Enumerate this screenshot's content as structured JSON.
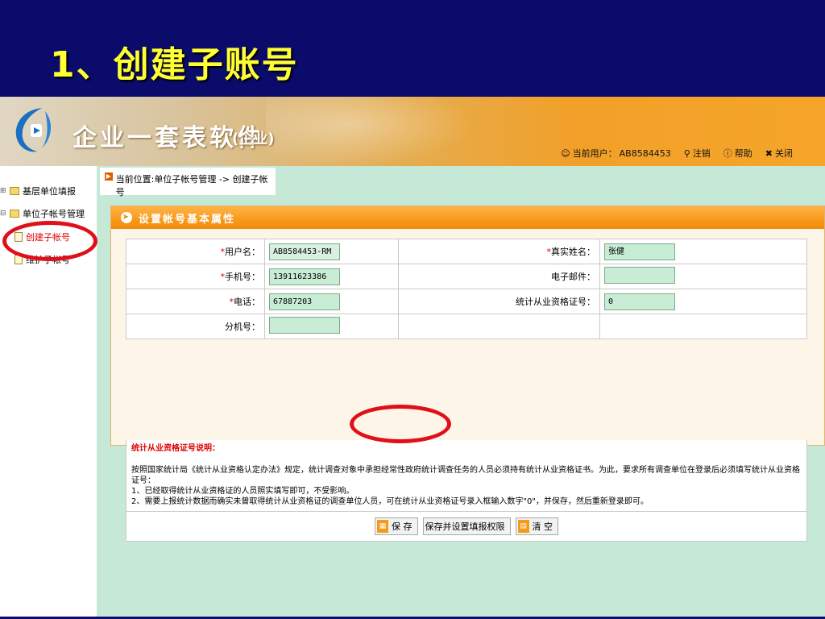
{
  "slide": {
    "title": "1、创建子账号"
  },
  "header": {
    "app_name": "企业一套表软件",
    "app_sub": "(企业)",
    "current_user_label": "当前用户：",
    "current_user": "AB8584453",
    "logout": "注销",
    "help": "帮助",
    "close": "关闭"
  },
  "sidebar": {
    "items": [
      {
        "label": "基层单位填报"
      },
      {
        "label": "单位子帐号管理"
      },
      {
        "label": "创建子帐号"
      },
      {
        "label": "维护子帐号"
      }
    ]
  },
  "breadcrumb": {
    "text": "当前位置:单位子帐号管理 -> 创建子帐号"
  },
  "panel": {
    "title": "设置帐号基本属性"
  },
  "form": {
    "username_label": "用户名：",
    "username_value": "AB8584453-RM",
    "realname_label": "真实姓名：",
    "realname_value": "张健",
    "mobile_label": "手机号：",
    "mobile_value": "13911623386",
    "email_label": "电子邮件：",
    "email_value": "",
    "phone_label": "电话：",
    "phone_value": "67887203",
    "cert_label": "统计从业资格证号：",
    "cert_value": "0",
    "ext_label": "分机号：",
    "ext_value": ""
  },
  "notes": {
    "title": "统计从业资格证号说明：",
    "line1": "按照国家统计局《统计从业资格认定办法》规定，统计调查对象中承担经常性政府统计调查任务的人员必须持有统计从业资格证书。为此，要求所有调查单位在登录后必须填写统计从业资格证号：",
    "line2": "1、已经取得统计从业资格证的人员照实填写即可，不受影响。",
    "line3": "2、需要上报统计数据而确实未曾取得统计从业资格证的调查单位人员，可在统计从业资格证号录入框输入数字\"0\"，并保存，然后重新登录即可。"
  },
  "buttons": {
    "save": "保 存",
    "save_perm": "保存并设置填报权限",
    "clear": "清 空"
  },
  "colors": {
    "slide_bg": "#0b0b6b",
    "title": "#ffff33",
    "app_bg": "#c6e8d6",
    "accent": "#f79a1b",
    "annotation": "#e0101a"
  }
}
